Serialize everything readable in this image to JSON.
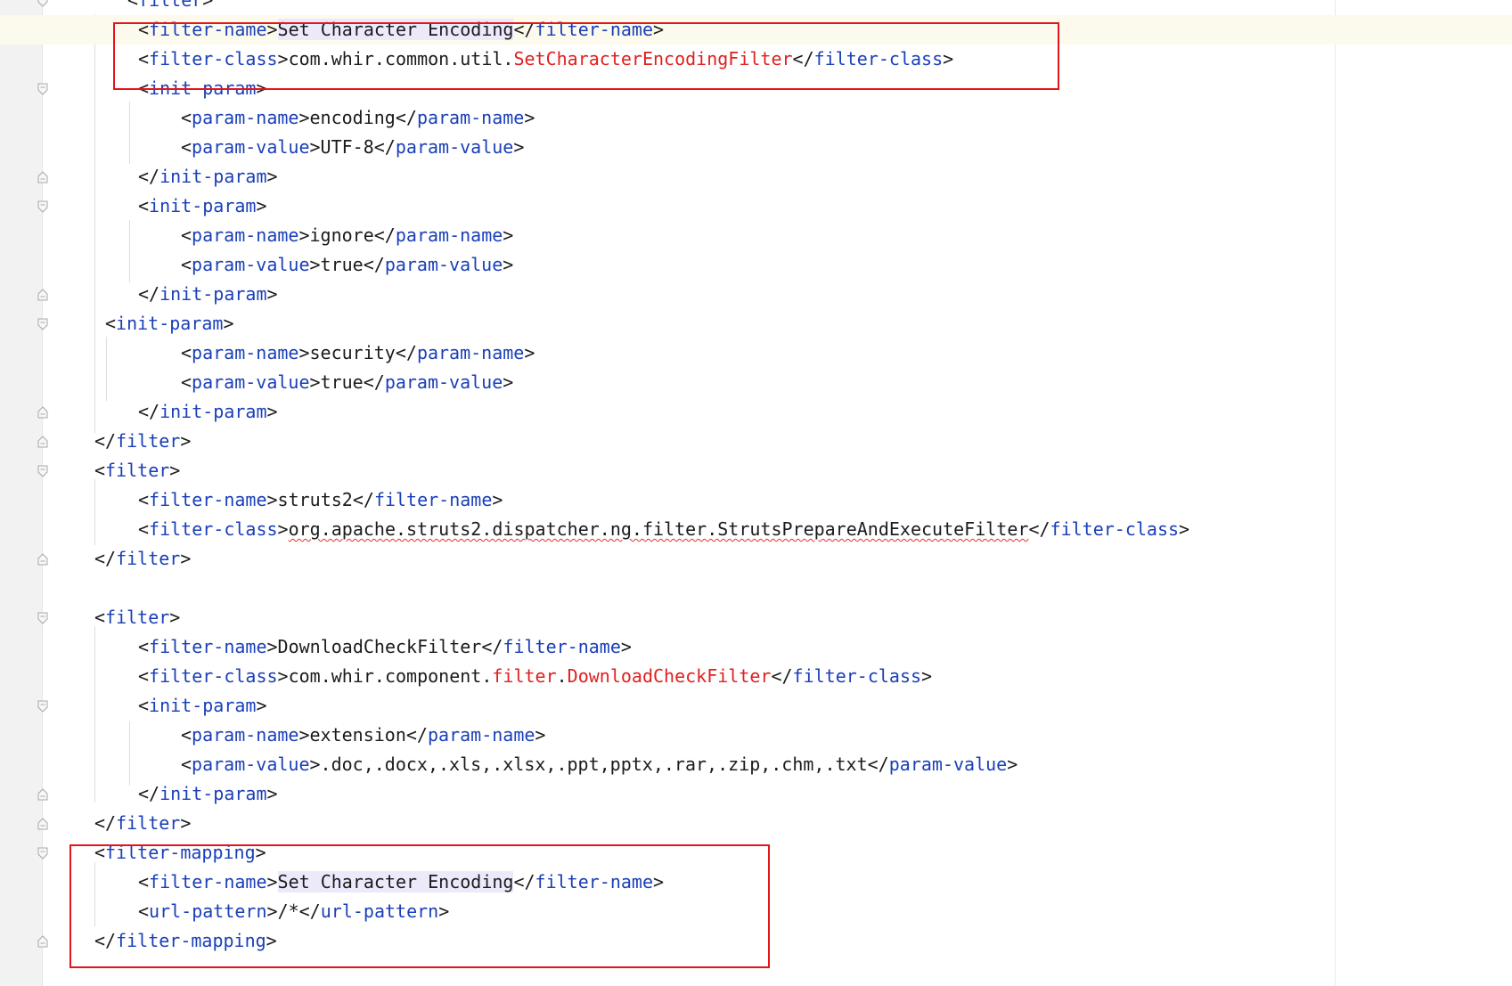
{
  "editor": {
    "language": "XML",
    "colors": {
      "tag": "#1a3fb8",
      "text": "#1b1b1b",
      "unresolved": "#e02020",
      "annotation_box": "#e4141b",
      "current_line": "#fcfaed"
    },
    "lines": [
      {
        "tokens": [
          {
            "t": "<",
            "c": "br"
          },
          {
            "t": "filter",
            "c": "tag"
          },
          {
            "t": ">",
            "c": "br"
          }
        ]
      },
      {
        "tokens": [
          {
            "t": "<",
            "c": "br"
          },
          {
            "t": "filter-name",
            "c": "tag"
          },
          {
            "t": ">",
            "c": "br"
          },
          {
            "t": "Set Character Encoding",
            "c": "txt hl"
          },
          {
            "t": "</",
            "c": "br"
          },
          {
            "t": "filter-name",
            "c": "tag"
          },
          {
            "t": ">",
            "c": "br"
          }
        ]
      },
      {
        "tokens": [
          {
            "t": "<",
            "c": "br"
          },
          {
            "t": "filter-class",
            "c": "tag"
          },
          {
            "t": ">",
            "c": "br"
          },
          {
            "t": "com.whir.common.util.",
            "c": "txt"
          },
          {
            "t": "SetCharacterEncodingFilter",
            "c": "red"
          },
          {
            "t": "</",
            "c": "br"
          },
          {
            "t": "filter-class",
            "c": "tag"
          },
          {
            "t": ">",
            "c": "br"
          }
        ]
      },
      {
        "tokens": [
          {
            "t": "<",
            "c": "br"
          },
          {
            "t": "init-param",
            "c": "tag"
          },
          {
            "t": ">",
            "c": "br"
          }
        ]
      },
      {
        "tokens": [
          {
            "t": "<",
            "c": "br"
          },
          {
            "t": "param-name",
            "c": "tag"
          },
          {
            "t": ">",
            "c": "br"
          },
          {
            "t": "encoding",
            "c": "txt"
          },
          {
            "t": "</",
            "c": "br"
          },
          {
            "t": "param-name",
            "c": "tag"
          },
          {
            "t": ">",
            "c": "br"
          }
        ]
      },
      {
        "tokens": [
          {
            "t": "<",
            "c": "br"
          },
          {
            "t": "param-value",
            "c": "tag"
          },
          {
            "t": ">",
            "c": "br"
          },
          {
            "t": "UTF-8",
            "c": "txt"
          },
          {
            "t": "</",
            "c": "br"
          },
          {
            "t": "param-value",
            "c": "tag"
          },
          {
            "t": ">",
            "c": "br"
          }
        ]
      },
      {
        "tokens": [
          {
            "t": "</",
            "c": "br"
          },
          {
            "t": "init-param",
            "c": "tag"
          },
          {
            "t": ">",
            "c": "br"
          }
        ]
      },
      {
        "tokens": [
          {
            "t": "<",
            "c": "br"
          },
          {
            "t": "init-param",
            "c": "tag"
          },
          {
            "t": ">",
            "c": "br"
          }
        ]
      },
      {
        "tokens": [
          {
            "t": "<",
            "c": "br"
          },
          {
            "t": "param-name",
            "c": "tag"
          },
          {
            "t": ">",
            "c": "br"
          },
          {
            "t": "ignore",
            "c": "txt"
          },
          {
            "t": "</",
            "c": "br"
          },
          {
            "t": "param-name",
            "c": "tag"
          },
          {
            "t": ">",
            "c": "br"
          }
        ]
      },
      {
        "tokens": [
          {
            "t": "<",
            "c": "br"
          },
          {
            "t": "param-value",
            "c": "tag"
          },
          {
            "t": ">",
            "c": "br"
          },
          {
            "t": "true",
            "c": "txt"
          },
          {
            "t": "</",
            "c": "br"
          },
          {
            "t": "param-value",
            "c": "tag"
          },
          {
            "t": ">",
            "c": "br"
          }
        ]
      },
      {
        "tokens": [
          {
            "t": "</",
            "c": "br"
          },
          {
            "t": "init-param",
            "c": "tag"
          },
          {
            "t": ">",
            "c": "br"
          }
        ]
      },
      {
        "tokens": [
          {
            "t": "<",
            "c": "br"
          },
          {
            "t": "init-param",
            "c": "tag"
          },
          {
            "t": ">",
            "c": "br"
          }
        ]
      },
      {
        "tokens": [
          {
            "t": "<",
            "c": "br"
          },
          {
            "t": "param-name",
            "c": "tag"
          },
          {
            "t": ">",
            "c": "br"
          },
          {
            "t": "security",
            "c": "txt"
          },
          {
            "t": "</",
            "c": "br"
          },
          {
            "t": "param-name",
            "c": "tag"
          },
          {
            "t": ">",
            "c": "br"
          }
        ]
      },
      {
        "tokens": [
          {
            "t": "<",
            "c": "br"
          },
          {
            "t": "param-value",
            "c": "tag"
          },
          {
            "t": ">",
            "c": "br"
          },
          {
            "t": "true",
            "c": "txt"
          },
          {
            "t": "</",
            "c": "br"
          },
          {
            "t": "param-value",
            "c": "tag"
          },
          {
            "t": ">",
            "c": "br"
          }
        ]
      },
      {
        "tokens": [
          {
            "t": "</",
            "c": "br"
          },
          {
            "t": "init-param",
            "c": "tag"
          },
          {
            "t": ">",
            "c": "br"
          }
        ]
      },
      {
        "tokens": [
          {
            "t": "</",
            "c": "br"
          },
          {
            "t": "filter",
            "c": "tag"
          },
          {
            "t": ">",
            "c": "br"
          }
        ]
      },
      {
        "tokens": [
          {
            "t": "<",
            "c": "br"
          },
          {
            "t": "filter",
            "c": "tag"
          },
          {
            "t": ">",
            "c": "br"
          }
        ]
      },
      {
        "tokens": [
          {
            "t": "<",
            "c": "br"
          },
          {
            "t": "filter-name",
            "c": "tag"
          },
          {
            "t": ">",
            "c": "br"
          },
          {
            "t": "struts2",
            "c": "txt"
          },
          {
            "t": "</",
            "c": "br"
          },
          {
            "t": "filter-name",
            "c": "tag"
          },
          {
            "t": ">",
            "c": "br"
          }
        ]
      },
      {
        "tokens": [
          {
            "t": "<",
            "c": "br"
          },
          {
            "t": "filter-class",
            "c": "tag"
          },
          {
            "t": ">",
            "c": "br"
          },
          {
            "t": "org.apache.struts2.dispatcher.ng.filter.StrutsPrepareAndExecuteFilter",
            "c": "txt squiggle"
          },
          {
            "t": "</",
            "c": "br"
          },
          {
            "t": "filter-class",
            "c": "tag"
          },
          {
            "t": ">",
            "c": "br"
          }
        ]
      },
      {
        "tokens": [
          {
            "t": "</",
            "c": "br"
          },
          {
            "t": "filter",
            "c": "tag"
          },
          {
            "t": ">",
            "c": "br"
          }
        ]
      },
      {
        "tokens": []
      },
      {
        "tokens": [
          {
            "t": "<",
            "c": "br"
          },
          {
            "t": "filter",
            "c": "tag"
          },
          {
            "t": ">",
            "c": "br"
          }
        ]
      },
      {
        "tokens": [
          {
            "t": "<",
            "c": "br"
          },
          {
            "t": "filter-name",
            "c": "tag"
          },
          {
            "t": ">",
            "c": "br"
          },
          {
            "t": "DownloadCheckFilter",
            "c": "txt"
          },
          {
            "t": "</",
            "c": "br"
          },
          {
            "t": "filter-name",
            "c": "tag"
          },
          {
            "t": ">",
            "c": "br"
          }
        ]
      },
      {
        "tokens": [
          {
            "t": "<",
            "c": "br"
          },
          {
            "t": "filter-class",
            "c": "tag"
          },
          {
            "t": ">",
            "c": "br"
          },
          {
            "t": "com.whir.component.",
            "c": "txt"
          },
          {
            "t": "filter",
            "c": "red"
          },
          {
            "t": ".",
            "c": "txt"
          },
          {
            "t": "DownloadCheckFilter",
            "c": "red"
          },
          {
            "t": "</",
            "c": "br"
          },
          {
            "t": "filter-class",
            "c": "tag"
          },
          {
            "t": ">",
            "c": "br"
          }
        ]
      },
      {
        "tokens": [
          {
            "t": "<",
            "c": "br"
          },
          {
            "t": "init-param",
            "c": "tag"
          },
          {
            "t": ">",
            "c": "br"
          }
        ]
      },
      {
        "tokens": [
          {
            "t": "<",
            "c": "br"
          },
          {
            "t": "param-name",
            "c": "tag"
          },
          {
            "t": ">",
            "c": "br"
          },
          {
            "t": "extension",
            "c": "txt"
          },
          {
            "t": "</",
            "c": "br"
          },
          {
            "t": "param-name",
            "c": "tag"
          },
          {
            "t": ">",
            "c": "br"
          }
        ]
      },
      {
        "tokens": [
          {
            "t": "<",
            "c": "br"
          },
          {
            "t": "param-value",
            "c": "tag"
          },
          {
            "t": ">",
            "c": "br"
          },
          {
            "t": ".doc,.docx,.xls,.xlsx,.ppt,pptx,.rar,.zip,.chm,.txt",
            "c": "txt"
          },
          {
            "t": "</",
            "c": "br"
          },
          {
            "t": "param-value",
            "c": "tag"
          },
          {
            "t": ">",
            "c": "br"
          }
        ]
      },
      {
        "tokens": [
          {
            "t": "</",
            "c": "br"
          },
          {
            "t": "init-param",
            "c": "tag"
          },
          {
            "t": ">",
            "c": "br"
          }
        ]
      },
      {
        "tokens": [
          {
            "t": "</",
            "c": "br"
          },
          {
            "t": "filter",
            "c": "tag"
          },
          {
            "t": ">",
            "c": "br"
          }
        ]
      },
      {
        "tokens": [
          {
            "t": "<",
            "c": "br"
          },
          {
            "t": "filter-mapping",
            "c": "tag"
          },
          {
            "t": ">",
            "c": "br"
          }
        ]
      },
      {
        "tokens": [
          {
            "t": "<",
            "c": "br"
          },
          {
            "t": "filter-name",
            "c": "tag"
          },
          {
            "t": ">",
            "c": "br"
          },
          {
            "t": "Set Character Encoding",
            "c": "txt hl"
          },
          {
            "t": "</",
            "c": "br"
          },
          {
            "t": "filter-name",
            "c": "tag"
          },
          {
            "t": ">",
            "c": "br"
          }
        ]
      },
      {
        "tokens": [
          {
            "t": "<",
            "c": "br"
          },
          {
            "t": "url-pattern",
            "c": "tag"
          },
          {
            "t": ">",
            "c": "br"
          },
          {
            "t": "/*",
            "c": "txt"
          },
          {
            "t": "</",
            "c": "br"
          },
          {
            "t": "url-pattern",
            "c": "tag"
          },
          {
            "t": ">",
            "c": "br"
          }
        ]
      },
      {
        "tokens": [
          {
            "t": "</",
            "c": "br"
          },
          {
            "t": "filter-mapping",
            "c": "tag"
          },
          {
            "t": ">",
            "c": "br"
          }
        ]
      }
    ]
  }
}
